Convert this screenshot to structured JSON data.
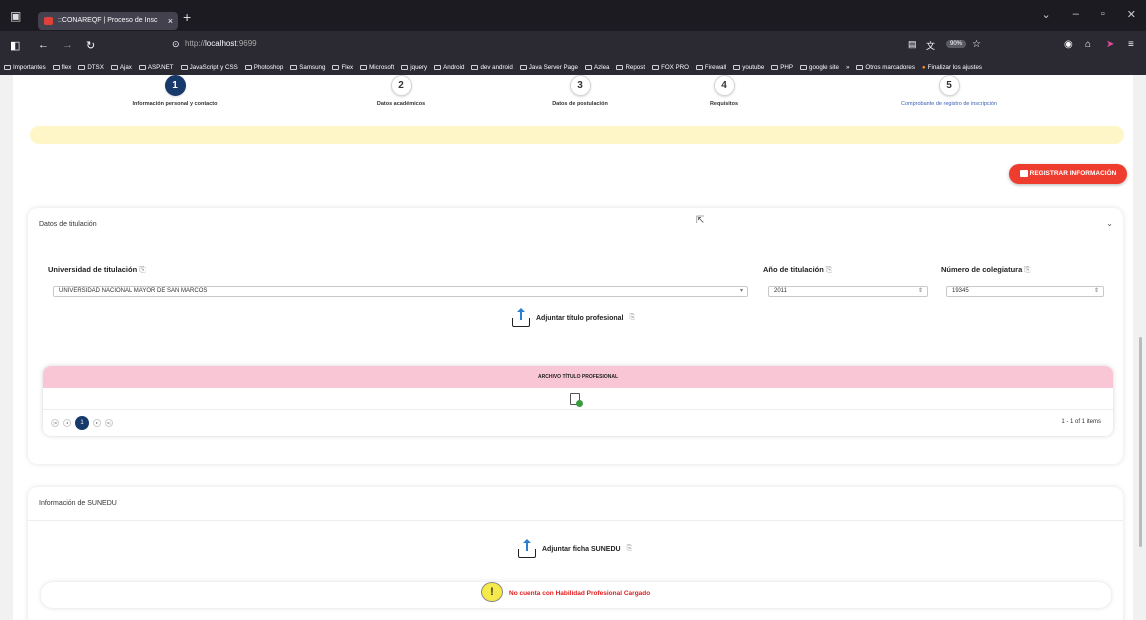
{
  "browser": {
    "tab_title": "::CONAREQF | Proceso de Insc",
    "tab_close": "×",
    "new_tab": "+",
    "url_prefix": "http://",
    "url_host": "localhost",
    "url_port": ":9699",
    "zoom": "90%",
    "bookmarks": [
      "Importantes",
      "flex",
      "DTSX",
      "Ajax",
      "ASP.NET",
      "JavaScript y CSS",
      "Photoshop",
      "Samsung",
      "Flex",
      "Microsoft",
      "jquery",
      "Android",
      "dev android",
      "Java Server Page",
      "Azlea",
      "Repost",
      "FOX PRO",
      "Firewall",
      "youtube",
      "PHP",
      "google site"
    ],
    "bookmarks_more": "»",
    "bookmarks_other": "Otros marcadores",
    "bookmarks_finish": "Finalizar los ajustes"
  },
  "steps": [
    {
      "num": "1",
      "label": "Información personal y contacto"
    },
    {
      "num": "2",
      "label": "Datos académicos"
    },
    {
      "num": "3",
      "label": "Datos de postulación"
    },
    {
      "num": "4",
      "label": "Requisitos"
    },
    {
      "num": "5",
      "label": "Comprobante de registro de inscripción"
    }
  ],
  "register_button": "REGISTRAR INFORMACIÓN",
  "titulacion": {
    "title": "Datos de titulación",
    "univ_label": "Universidad de titulación",
    "univ_value": "UNIVERSIDAD NACIONAL MAYOR DE SAN MARCOS",
    "year_label": "Año de titulación",
    "year_value": "2011",
    "coleg_label": "Número de colegiatura",
    "coleg_value": "19345",
    "upload_label": "Adjuntar título profesional",
    "grid_header": "ARCHIVO TÍTULO PROFESIONAL",
    "page_current": "1",
    "items_info": "1 - 1 of 1 items"
  },
  "sunedu": {
    "title": "Información de SUNEDU",
    "upload_label": "Adjuntar ficha SUNEDU",
    "alert_icon": "!",
    "alert_text": "No cuenta con Habilidad Profesional Cargado"
  }
}
